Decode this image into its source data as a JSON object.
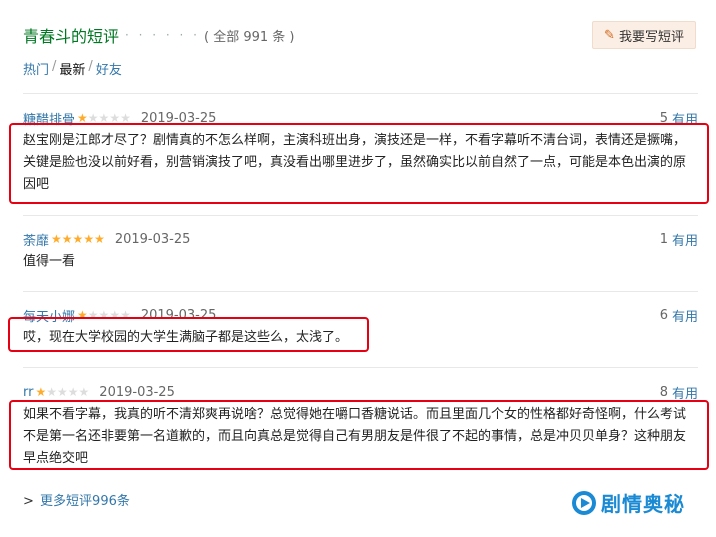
{
  "header": {
    "title": "青春斗的短评",
    "dots": "· · · · · ·",
    "count_text": "( 全部 991 条 )",
    "write_button": "我要写短评"
  },
  "tabs": [
    {
      "label": "热门"
    },
    {
      "label": "最新"
    },
    {
      "label": "好友"
    }
  ],
  "tab_separator": "/",
  "useful_suffix": "有用",
  "star_on": "★",
  "star_off": "★",
  "comments": [
    {
      "user": "糖醋排骨",
      "rating": 1,
      "date": "2019-03-25",
      "useful": "5",
      "text": "赵宝刚是江郎才尽了？剧情真的不怎么样啊，主演科班出身，演技还是一样，不看字幕听不清台词，表情还是撅嘴，关键是脸也没以前好看，别营销演技了吧，真没看出哪里进步了，虽然确实比以前自然了一点，可能是本色出演的原因吧"
    },
    {
      "user": "荼靡",
      "rating": 5,
      "date": "2019-03-25",
      "useful": "1",
      "text": "值得一看"
    },
    {
      "user": "每天小娜",
      "rating": 1,
      "date": "2019-03-25",
      "useful": "6",
      "text": "哎，现在大学校园的大学生满脑子都是这些么，太浅了。"
    },
    {
      "user": "rr",
      "rating": 1,
      "date": "2019-03-25",
      "useful": "8",
      "text": "如果不看字幕，我真的听不清郑爽再说啥？总觉得她在嚼口香糖说话。而且里面几个女的性格都好奇怪啊，什么考试不是第一名还非要第一名道歉的，而且向真总是觉得自己有男朋友是件很了不起的事情，总是冲贝贝单身？这种朋友早点绝交吧"
    }
  ],
  "more_link": {
    "arrow": ">",
    "label": "更多短评996条"
  },
  "watermark": {
    "text": "剧情奥秘"
  },
  "colors": {
    "title_green": "#007722",
    "link_blue": "#3377aa",
    "star_orange": "#ffac2d",
    "highlight_red": "#e60012",
    "watermark_blue": "#1a8ad4"
  }
}
